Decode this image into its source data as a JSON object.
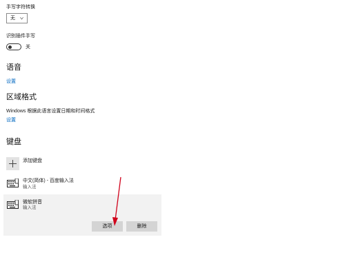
{
  "handwriting": {
    "label": "手写字符转换",
    "dropdown_value": "无"
  },
  "pen_handwriting": {
    "label": "识别插件手写",
    "toggle_state": "关"
  },
  "speech": {
    "heading": "语音",
    "link": "设置"
  },
  "region": {
    "heading": "区域格式",
    "description": "Windows 根据此语言设置日期和时间格式",
    "link": "设置"
  },
  "keyboards": {
    "heading": "键盘",
    "add_label": "添加键盘",
    "items": [
      {
        "name": "中文(简体) - 百度输入法",
        "type": "输入法"
      },
      {
        "name": "微软拼音",
        "type": "输入法"
      }
    ],
    "options_button": "选项",
    "remove_button": "删除"
  },
  "colors": {
    "link": "#0067c0",
    "arrow": "#d0021b",
    "button": "#d4d4d4",
    "panel": "#f2f2f2"
  }
}
